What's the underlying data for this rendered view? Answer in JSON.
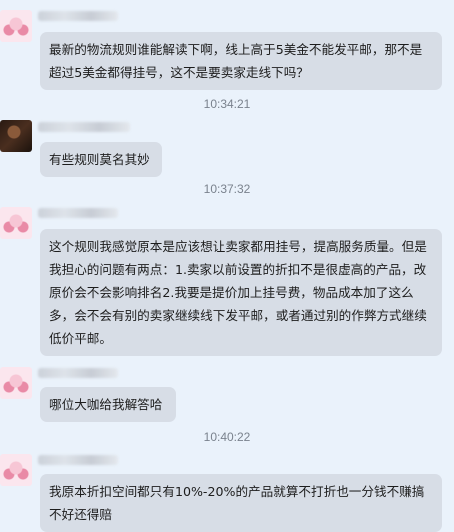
{
  "messages": [
    {
      "sender_style": "pink",
      "text": "最新的物流规则谁能解读下啊，线上高于5美金不能发平邮，那不是超过5美金都得挂号，这不是要卖家走线下吗？"
    },
    {
      "sender_style": "dark",
      "text": "有些规则莫名其妙"
    },
    {
      "sender_style": "pink",
      "text": "这个规则我感觉原本是应该想让卖家都用挂号，提高服务质量。但是我担心的问题有两点：1.卖家以前设置的折扣不是很虚高的产品，改原价会不会影响排名2.我要是提价加上挂号费，物品成本加了这么多，会不会有别的卖家继续线下发平邮，或者通过别的作弊方式继续低价平邮。"
    },
    {
      "sender_style": "pink",
      "text": "哪位大咖给我解答哈"
    },
    {
      "sender_style": "pink",
      "text": "我原本折扣空间都只有10%-20%的产品就算不打折也一分钱不赚搞不好还得赔"
    }
  ],
  "timestamps": [
    "10:34:21",
    "10:37:32",
    "10:40:22"
  ]
}
